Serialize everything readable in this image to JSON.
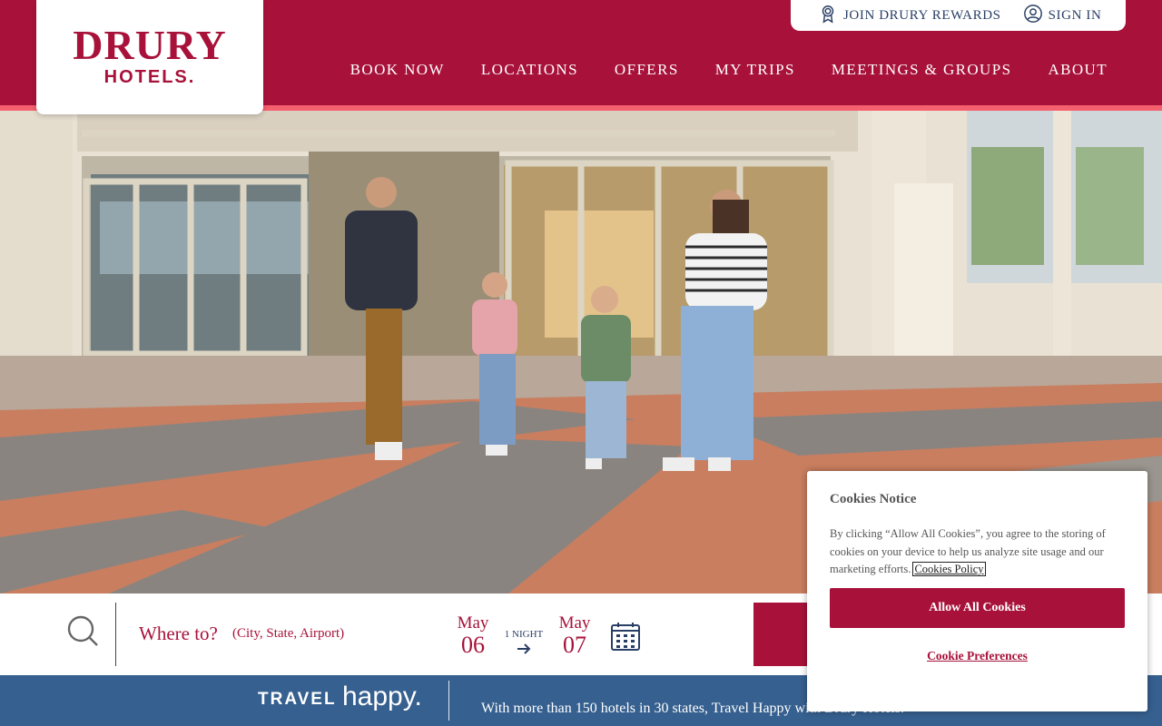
{
  "brand": {
    "logo_word_1": "DRURY",
    "logo_word_2": "HOTELS.",
    "primary_color": "#a8123a",
    "accent_stripe_color": "#f4606e",
    "navy_color": "#2a3f66"
  },
  "utility": {
    "rewards_label": "JOIN DRURY REWARDS",
    "rewards_icon": "award-ribbon-icon",
    "signin_label": "SIGN IN",
    "signin_icon": "user-circle-icon"
  },
  "nav": {
    "items": [
      {
        "label": "BOOK NOW"
      },
      {
        "label": "LOCATIONS"
      },
      {
        "label": "OFFERS"
      },
      {
        "label": "MY TRIPS"
      },
      {
        "label": "MEETINGS & GROUPS"
      },
      {
        "label": "ABOUT"
      }
    ]
  },
  "booking": {
    "search_icon": "search-icon",
    "where_label": "Where to?",
    "where_hint": "(City, State, Airport)",
    "checkin": {
      "month": "May",
      "day": "06"
    },
    "nights": "1 NIGHT",
    "checkout": {
      "month": "May",
      "day": "07"
    },
    "calendar_icon": "calendar-icon"
  },
  "travel_banner": {
    "logo_travel": "TRAVEL",
    "logo_happy": "happy.",
    "text": "With more than 150 hotels in 30 states, Travel Happy with Drury Hotels."
  },
  "cookie_notice": {
    "title": "Cookies Notice",
    "body": "By clicking “Allow All Cookies”, you agree to the storing of cookies on your device to help us analyze site usage and our marketing efforts.",
    "policy_link": "Cookies Policy",
    "allow_button": "Allow All Cookies",
    "preferences_link": "Cookie Preferences"
  }
}
